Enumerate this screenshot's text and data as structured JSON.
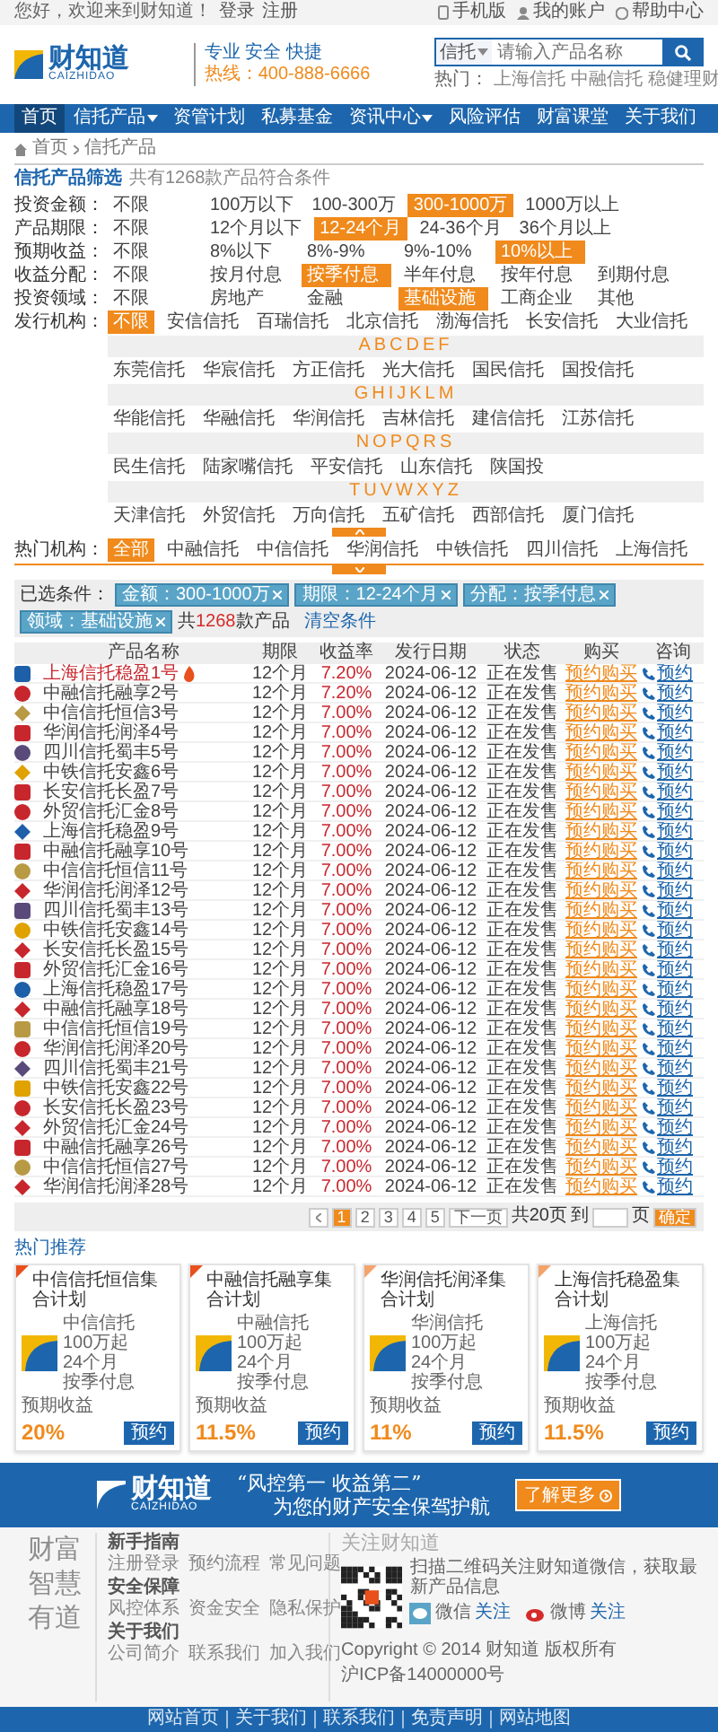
{
  "top_bar": {
    "greeting": "您好，欢迎来到财知道！",
    "auth": [
      "登录",
      "注册"
    ],
    "links": [
      {
        "kind": "phone",
        "label": "手机版"
      },
      {
        "kind": "user",
        "label": "我的账户"
      },
      {
        "kind": "help",
        "label": "帮助中心"
      }
    ]
  },
  "header": {
    "logo": "财知道",
    "logo_sub": "CAIZHIDAO",
    "slogan": "专业 安全 快捷",
    "hotline": "热线：400-888-6666",
    "search": {
      "scope": "信托",
      "placeholder": "请输入产品名称"
    },
    "hot_label": "热门：",
    "hot": [
      "上海信托",
      "中融信托",
      "稳健理财"
    ]
  },
  "nav": [
    {
      "label": "首页",
      "selected": true,
      "caret": false
    },
    {
      "label": "信托产品",
      "selected": false,
      "caret": true
    },
    {
      "label": "资管计划",
      "selected": false,
      "caret": false
    },
    {
      "label": "私募基金",
      "selected": false,
      "caret": false
    },
    {
      "label": "资讯中心",
      "selected": false,
      "caret": true
    },
    {
      "label": "风险评估",
      "selected": false,
      "caret": false
    },
    {
      "label": "财富课堂",
      "selected": false,
      "caret": false
    },
    {
      "label": "关于我们",
      "selected": false,
      "caret": false
    }
  ],
  "breadcrumb": [
    "首页",
    "信托产品"
  ],
  "filter_title": "信托产品筛选",
  "filter_hint": "共有1268款产品符合条件",
  "filters": [
    {
      "label": "投资金额：",
      "options": [
        {
          "label": "不限",
          "selected": false
        },
        {
          "label": "100万以下",
          "selected": false
        },
        {
          "label": "100-300万",
          "selected": false
        },
        {
          "label": "300-1000万",
          "selected": true
        },
        {
          "label": "1000万以上",
          "selected": false
        }
      ]
    },
    {
      "label": "产品期限：",
      "options": [
        {
          "label": "不限",
          "selected": false
        },
        {
          "label": "12个月以下",
          "selected": false
        },
        {
          "label": "12-24个月",
          "selected": true
        },
        {
          "label": "24-36个月",
          "selected": false
        },
        {
          "label": "36个月以上",
          "selected": false
        }
      ]
    },
    {
      "label": "预期收益：",
      "options": [
        {
          "label": "不限",
          "selected": false
        },
        {
          "label": "8%以下",
          "selected": false
        },
        {
          "label": "8%-9%",
          "selected": false
        },
        {
          "label": "9%-10%",
          "selected": false
        },
        {
          "label": "10%以上",
          "selected": true
        }
      ]
    },
    {
      "label": "收益分配：",
      "options": [
        {
          "label": "不限",
          "selected": false
        },
        {
          "label": "按月付息",
          "selected": false
        },
        {
          "label": "按季付息",
          "selected": true
        },
        {
          "label": "半年付息",
          "selected": false
        },
        {
          "label": "按年付息",
          "selected": false
        },
        {
          "label": "到期付息",
          "selected": false
        }
      ]
    },
    {
      "label": "投资领域：",
      "options": [
        {
          "label": "不限",
          "selected": false
        },
        {
          "label": "房地产",
          "selected": false
        },
        {
          "label": "金融",
          "selected": false
        },
        {
          "label": "基础设施",
          "selected": true
        },
        {
          "label": "工商企业",
          "selected": false
        },
        {
          "label": "其他",
          "selected": false
        }
      ]
    }
  ],
  "issuer": {
    "label": "发行机构：",
    "options": [
      {
        "label": "不限",
        "selected": true
      },
      {
        "label": "安信信托",
        "selected": false
      },
      {
        "label": "百瑞信托",
        "selected": false
      },
      {
        "label": "北京信托",
        "selected": false
      },
      {
        "label": "渤海信托",
        "selected": false
      },
      {
        "label": "长安信托",
        "selected": false
      },
      {
        "label": "大业信托",
        "selected": false
      }
    ],
    "groups": [
      {
        "title": "ABCDEF",
        "options": [
          "东莞信托",
          "华宸信托",
          "方正信托",
          "光大信托",
          "国民信托",
          "国投信托"
        ]
      },
      {
        "title": "GHIJKLM",
        "options": [
          "华能信托",
          "华融信托",
          "华润信托",
          "吉林信托",
          "建信信托",
          "江苏信托"
        ]
      },
      {
        "title": "NOPQRS",
        "options": [
          "民生信托",
          "陆家嘴信托",
          "平安信托",
          "山东信托",
          "陕国投"
        ]
      },
      {
        "title": "TUVWXYZ",
        "options": [
          "天津信托",
          "外贸信托",
          "万向信托",
          "五矿信托",
          "西部信托",
          "厦门信托"
        ]
      }
    ]
  },
  "sort": {
    "label": "热门机构：",
    "options": [
      {
        "label": "全部",
        "selected": true
      },
      {
        "label": "中融信托",
        "selected": false
      },
      {
        "label": "中信信托",
        "selected": false
      },
      {
        "label": "华润信托",
        "selected": false
      },
      {
        "label": "中铁信托",
        "selected": false
      },
      {
        "label": "四川信托",
        "selected": false
      },
      {
        "label": "上海信托",
        "selected": false
      }
    ]
  },
  "selected_filters": {
    "label": "已选条件：",
    "chips": [
      "金额：300-1000万",
      "期限：12-24个月",
      "分配：按季付息",
      "领域：基础设施"
    ],
    "count_prefix": "共",
    "count": "1268",
    "count_suffix": "款产品",
    "clear": "清空条件"
  },
  "table": {
    "columns": [
      "产品名称",
      "期限",
      "收益率",
      "发行日期",
      "状态",
      "购买",
      "咨询"
    ],
    "rows": [
      {
        "name": "上海信托稳盈1号",
        "hot": true,
        "color": "#1d5fa8",
        "period": "12个月",
        "yield": "7.20%",
        "date": "2024-06-12",
        "status": "正在发售",
        "action": "预约购买",
        "call": "预约"
      },
      {
        "name": "中融信托融享2号",
        "hot": false,
        "color": "#c8262d",
        "period": "12个月",
        "yield": "7.20%",
        "date": "2024-06-12",
        "status": "正在发售",
        "action": "预约购买",
        "call": "预约"
      },
      {
        "name": "中信信托恒信3号",
        "hot": false,
        "color": "#b89a45",
        "period": "12个月",
        "yield": "7.00%",
        "date": "2024-06-12",
        "status": "正在发售",
        "action": "预约购买",
        "call": "预约"
      },
      {
        "name": "华润信托润泽4号",
        "hot": false,
        "color": "#c8262d",
        "period": "12个月",
        "yield": "7.00%",
        "date": "2024-06-12",
        "status": "正在发售",
        "action": "预约购买",
        "call": "预约"
      },
      {
        "name": "四川信托蜀丰5号",
        "hot": false,
        "color": "#5a4a7a",
        "period": "12个月",
        "yield": "7.00%",
        "date": "2024-06-12",
        "status": "正在发售",
        "action": "预约购买",
        "call": "预约"
      },
      {
        "name": "中铁信托安鑫6号",
        "hot": false,
        "color": "#e0a200",
        "period": "12个月",
        "yield": "7.00%",
        "date": "2024-06-12",
        "status": "正在发售",
        "action": "预约购买",
        "call": "预约"
      },
      {
        "name": "长安信托长盈7号",
        "hot": false,
        "color": "#c8262d",
        "period": "12个月",
        "yield": "7.00%",
        "date": "2024-06-12",
        "status": "正在发售",
        "action": "预约购买",
        "call": "预约"
      },
      {
        "name": "外贸信托汇金8号",
        "hot": false,
        "color": "#c8262d",
        "period": "12个月",
        "yield": "7.00%",
        "date": "2024-06-12",
        "status": "正在发售",
        "action": "预约购买",
        "call": "预约"
      },
      {
        "name": "上海信托稳盈9号",
        "hot": false,
        "color": "#1d5fa8",
        "period": "12个月",
        "yield": "7.00%",
        "date": "2024-06-12",
        "status": "正在发售",
        "action": "预约购买",
        "call": "预约"
      },
      {
        "name": "中融信托融享10号",
        "hot": false,
        "color": "#c8262d",
        "period": "12个月",
        "yield": "7.00%",
        "date": "2024-06-12",
        "status": "正在发售",
        "action": "预约购买",
        "call": "预约"
      },
      {
        "name": "中信信托恒信11号",
        "hot": false,
        "color": "#b89a45",
        "period": "12个月",
        "yield": "7.00%",
        "date": "2024-06-12",
        "status": "正在发售",
        "action": "预约购买",
        "call": "预约"
      },
      {
        "name": "华润信托润泽12号",
        "hot": false,
        "color": "#c8262d",
        "period": "12个月",
        "yield": "7.00%",
        "date": "2024-06-12",
        "status": "正在发售",
        "action": "预约购买",
        "call": "预约"
      },
      {
        "name": "四川信托蜀丰13号",
        "hot": false,
        "color": "#5a4a7a",
        "period": "12个月",
        "yield": "7.00%",
        "date": "2024-06-12",
        "status": "正在发售",
        "action": "预约购买",
        "call": "预约"
      },
      {
        "name": "中铁信托安鑫14号",
        "hot": false,
        "color": "#e0a200",
        "period": "12个月",
        "yield": "7.00%",
        "date": "2024-06-12",
        "status": "正在发售",
        "action": "预约购买",
        "call": "预约"
      },
      {
        "name": "长安信托长盈15号",
        "hot": false,
        "color": "#c8262d",
        "period": "12个月",
        "yield": "7.00%",
        "date": "2024-06-12",
        "status": "正在发售",
        "action": "预约购买",
        "call": "预约"
      },
      {
        "name": "外贸信托汇金16号",
        "hot": false,
        "color": "#c8262d",
        "period": "12个月",
        "yield": "7.00%",
        "date": "2024-06-12",
        "status": "正在发售",
        "action": "预约购买",
        "call": "预约"
      },
      {
        "name": "上海信托稳盈17号",
        "hot": false,
        "color": "#1d5fa8",
        "period": "12个月",
        "yield": "7.00%",
        "date": "2024-06-12",
        "status": "正在发售",
        "action": "预约购买",
        "call": "预约"
      },
      {
        "name": "中融信托融享18号",
        "hot": false,
        "color": "#c8262d",
        "period": "12个月",
        "yield": "7.00%",
        "date": "2024-06-12",
        "status": "正在发售",
        "action": "预约购买",
        "call": "预约"
      },
      {
        "name": "中信信托恒信19号",
        "hot": false,
        "color": "#b89a45",
        "period": "12个月",
        "yield": "7.00%",
        "date": "2024-06-12",
        "status": "正在发售",
        "action": "预约购买",
        "call": "预约"
      },
      {
        "name": "华润信托润泽20号",
        "hot": false,
        "color": "#c8262d",
        "period": "12个月",
        "yield": "7.00%",
        "date": "2024-06-12",
        "status": "正在发售",
        "action": "预约购买",
        "call": "预约"
      },
      {
        "name": "四川信托蜀丰21号",
        "hot": false,
        "color": "#5a4a7a",
        "period": "12个月",
        "yield": "7.00%",
        "date": "2024-06-12",
        "status": "正在发售",
        "action": "预约购买",
        "call": "预约"
      },
      {
        "name": "中铁信托安鑫22号",
        "hot": false,
        "color": "#e0a200",
        "period": "12个月",
        "yield": "7.00%",
        "date": "2024-06-12",
        "status": "正在发售",
        "action": "预约购买",
        "call": "预约"
      },
      {
        "name": "长安信托长盈23号",
        "hot": false,
        "color": "#c8262d",
        "period": "12个月",
        "yield": "7.00%",
        "date": "2024-06-12",
        "status": "正在发售",
        "action": "预约购买",
        "call": "预约"
      },
      {
        "name": "外贸信托汇金24号",
        "hot": false,
        "color": "#c8262d",
        "period": "12个月",
        "yield": "7.00%",
        "date": "2024-06-12",
        "status": "正在发售",
        "action": "预约购买",
        "call": "预约"
      },
      {
        "name": "中融信托融享26号",
        "hot": false,
        "color": "#c8262d",
        "period": "12个月",
        "yield": "7.00%",
        "date": "2024-06-12",
        "status": "正在发售",
        "action": "预约购买",
        "call": "预约"
      },
      {
        "name": "中信信托恒信27号",
        "hot": false,
        "color": "#b89a45",
        "period": "12个月",
        "yield": "7.00%",
        "date": "2024-06-12",
        "status": "正在发售",
        "action": "预约购买",
        "call": "预约"
      },
      {
        "name": "华润信托润泽28号",
        "hot": false,
        "color": "#c8262d",
        "period": "12个月",
        "yield": "7.00%",
        "date": "2024-06-12",
        "status": "正在发售",
        "action": "预约购买",
        "call": "预约"
      }
    ]
  },
  "pager": {
    "pages": [
      {
        "label": "1",
        "selected": true
      },
      {
        "label": "2",
        "selected": false
      },
      {
        "label": "3",
        "selected": false
      },
      {
        "label": "4",
        "selected": false
      },
      {
        "label": "5",
        "selected": false
      }
    ],
    "next": "下一页",
    "total": "共20页",
    "goto": "到",
    "unit": "页",
    "confirm": "确定"
  },
  "recommend": {
    "title": "热门推荐",
    "cards": [
      {
        "title": "中信信托恒信集合计划",
        "issuer": "中信信托",
        "threshold": "100万起",
        "period": "24个月",
        "payout": "按季付息",
        "yield_label": "预期收益",
        "yield": "20%",
        "button": "预约"
      },
      {
        "title": "中融信托融享集合计划",
        "issuer": "中融信托",
        "threshold": "100万起",
        "period": "24个月",
        "payout": "按季付息",
        "yield_label": "预期收益",
        "yield": "11.5%",
        "button": "预约"
      },
      {
        "title": "华润信托润泽集合计划",
        "issuer": "华润信托",
        "threshold": "100万起",
        "period": "24个月",
        "payout": "按季付息",
        "yield_label": "预期收益",
        "yield": "11%",
        "button": "预约"
      },
      {
        "title": "上海信托稳盈集合计划",
        "issuer": "上海信托",
        "threshold": "100万起",
        "period": "24个月",
        "payout": "按季付息",
        "yield_label": "预期收益",
        "yield": "11.5%",
        "button": "预约"
      }
    ]
  },
  "banner": {
    "logo": "财知道",
    "logo_sub": "CAIZHIDAO",
    "line1": "“风控第一 收益第二”",
    "line2": "为您的财产安全保驾护航",
    "button": "了解更多"
  },
  "footer": {
    "motto": [
      "财富",
      "智慧",
      "有道"
    ],
    "groups": [
      {
        "title": "新手指南",
        "links": [
          "注册登录",
          "预约流程",
          "常见问题"
        ]
      },
      {
        "title": "安全保障",
        "links": [
          "风控体系",
          "资金安全",
          "隐私保护"
        ]
      },
      {
        "title": "关于我们",
        "links": [
          "公司简介",
          "联系我们",
          "加入我们"
        ]
      }
    ],
    "follow_title": "关注财知道",
    "qr_text": "扫描二维码关注财知道微信，获取最新产品信息",
    "socials": [
      {
        "kind": "wechat",
        "name": "微信",
        "action": "关注"
      },
      {
        "kind": "weibo",
        "name": "微博",
        "action": "关注"
      }
    ],
    "copyright": [
      "Copyright © 2014 财知道 版权所有",
      "沪ICP备14000000号"
    ]
  },
  "bottom_links": [
    "网站首页",
    "关于我们",
    "联系我们",
    "免责声明",
    "网站地图"
  ]
}
